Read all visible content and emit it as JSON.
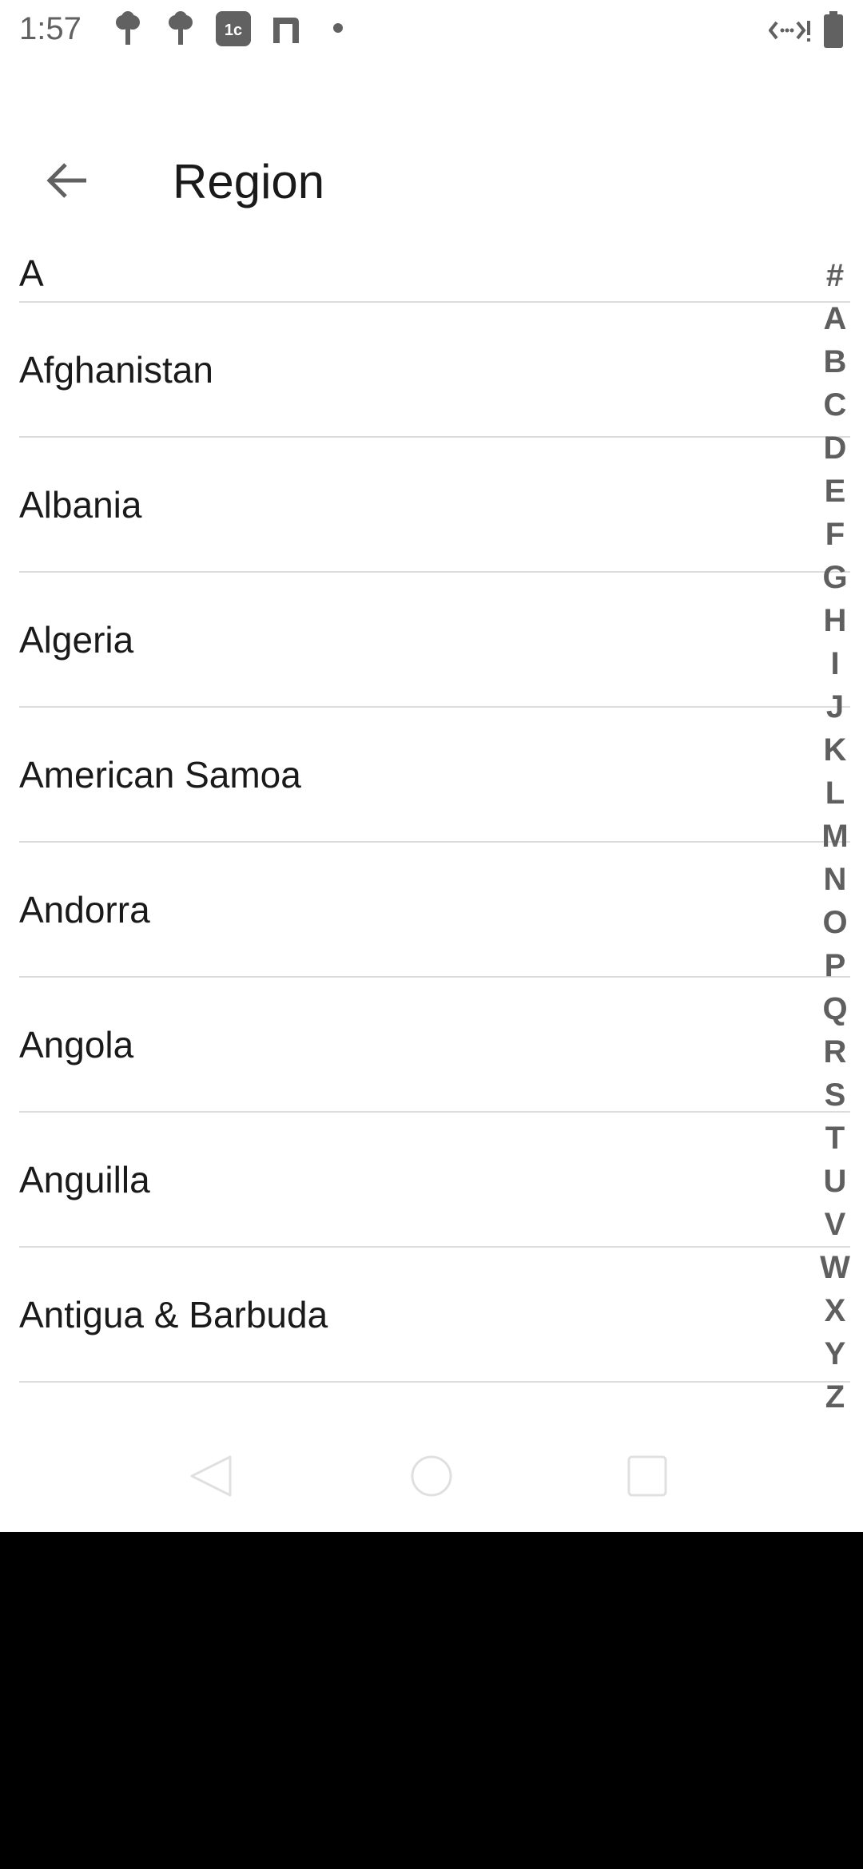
{
  "status_bar": {
    "time": "1:57",
    "icons": [
      "tree-icon",
      "tree-icon",
      "app-1c-icon",
      "app-n-icon",
      "dot-icon",
      "code-signal-icon",
      "battery-icon"
    ]
  },
  "app_bar": {
    "title": "Region",
    "back_icon": "arrow-left-icon"
  },
  "section": {
    "header": "A"
  },
  "countries": [
    {
      "label": "Afghanistan"
    },
    {
      "label": "Albania"
    },
    {
      "label": "Algeria"
    },
    {
      "label": "American Samoa"
    },
    {
      "label": "Andorra"
    },
    {
      "label": "Angola"
    },
    {
      "label": "Anguilla"
    },
    {
      "label": "Antigua & Barbuda"
    }
  ],
  "index_bar": [
    "#",
    "A",
    "B",
    "C",
    "D",
    "E",
    "F",
    "G",
    "H",
    "I",
    "J",
    "K",
    "L",
    "M",
    "N",
    "O",
    "P",
    "Q",
    "R",
    "S",
    "T",
    "U",
    "V",
    "W",
    "X",
    "Y",
    "Z"
  ],
  "nav_bar": {
    "back": "nav-back-icon",
    "home": "nav-home-icon",
    "recents": "nav-recents-icon"
  },
  "colors": {
    "text_primary": "#1a1a1a",
    "text_secondary": "#616161",
    "divider": "#dcdcdc",
    "background": "#ffffff"
  }
}
